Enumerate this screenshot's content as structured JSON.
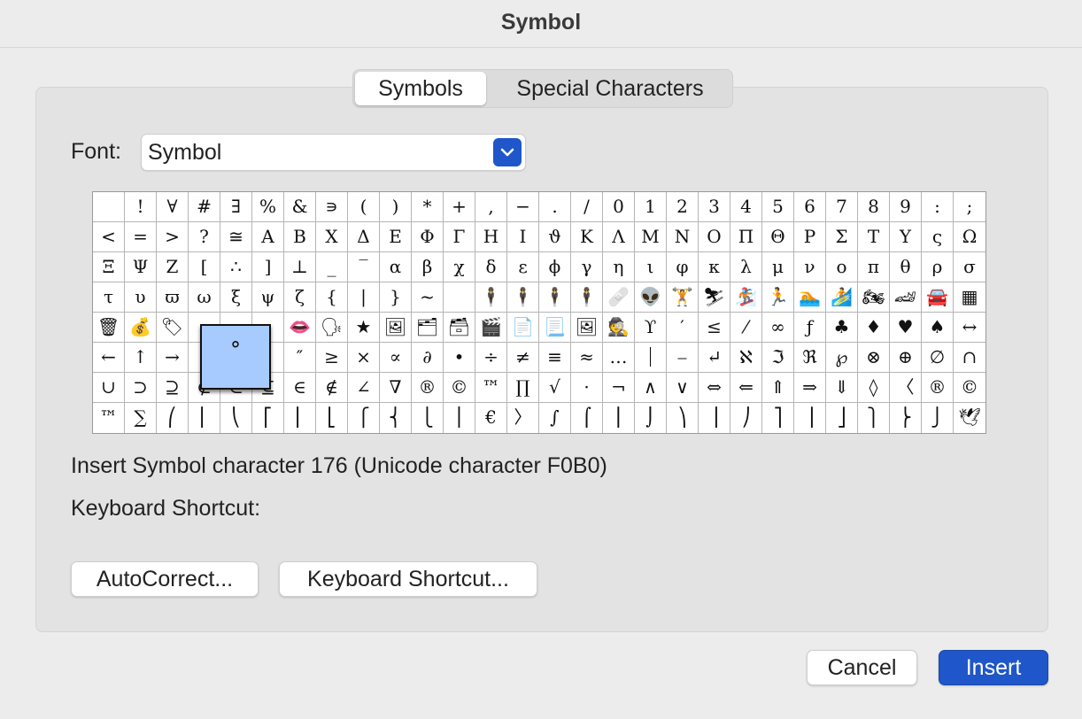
{
  "window": {
    "title": "Symbol"
  },
  "tabs": [
    {
      "label": "Symbols",
      "selected": true
    },
    {
      "label": "Special Characters",
      "selected": false
    }
  ],
  "font": {
    "label": "Font:",
    "value": "Symbol"
  },
  "grid": {
    "rows": [
      [
        "",
        "!",
        "∀",
        "#",
        "∃",
        "%",
        "&",
        "∍",
        "(",
        ")",
        "*",
        "+",
        ",",
        "−",
        ".",
        "/",
        "0",
        "1",
        "2",
        "3",
        "4",
        "5",
        "6",
        "7",
        "8",
        "9",
        ":",
        ";"
      ],
      [
        "<",
        "=",
        ">",
        "?",
        "≅",
        "Α",
        "Β",
        "Χ",
        "Δ",
        "Ε",
        "Φ",
        "Γ",
        "Η",
        "Ι",
        "ϑ",
        "Κ",
        "Λ",
        "Μ",
        "Ν",
        "Ο",
        "Π",
        "Θ",
        "Ρ",
        "Σ",
        "Τ",
        "Υ",
        "ς",
        "Ω"
      ],
      [
        "Ξ",
        "Ψ",
        "Ζ",
        "[",
        "∴",
        "]",
        "⊥",
        "_",
        "‾",
        "α",
        "β",
        "χ",
        "δ",
        "ε",
        "ϕ",
        "γ",
        "η",
        "ι",
        "φ",
        "κ",
        "λ",
        "μ",
        "ν",
        "ο",
        "π",
        "θ",
        "ρ",
        "σ"
      ],
      [
        "τ",
        "υ",
        "ϖ",
        "ω",
        "ξ",
        "ψ",
        "ζ",
        "{",
        "|",
        "}",
        "~",
        "",
        "🕴",
        "🕴",
        "🕴",
        "🕴",
        "🩹",
        "👽",
        "🏋",
        "⛷",
        "🏂",
        "🏃",
        "🏊",
        "🏄",
        "🏍",
        "🏎",
        "🚘",
        "▦"
      ],
      [
        "🗑",
        "💰",
        "🏷",
        "",
        "",
        "",
        "👄",
        "🗣",
        "★",
        "🖼",
        "🗂",
        "🗃",
        "🎬",
        "📄",
        "📃",
        "🖼",
        "🕵",
        "ϒ",
        "′",
        "≤",
        "⁄",
        "∞",
        "ƒ",
        "♣",
        "♦",
        "♥",
        "♠",
        "↔"
      ],
      [
        "←",
        "↑",
        "→",
        "",
        "",
        "",
        "″",
        "≥",
        "×",
        "∝",
        "∂",
        "•",
        "÷",
        "≠",
        "≡",
        "≈",
        "…",
        "⏐",
        "⎯",
        "↵",
        "ℵ",
        "ℑ",
        "ℜ",
        "℘",
        "⊗",
        "⊕",
        "∅",
        "∩"
      ],
      [
        "∪",
        "⊃",
        "⊇",
        "⊄",
        "⊂",
        "⊆",
        "∈",
        "∉",
        "∠",
        "∇",
        "®",
        "©",
        "™",
        "∏",
        "√",
        "⋅",
        "¬",
        "∧",
        "∨",
        "⇔",
        "⇐",
        "⇑",
        "⇒",
        "⇓",
        "◊",
        "〈",
        "®",
        "©"
      ],
      [
        "™",
        "∑",
        "⎛",
        "⎜",
        "⎝",
        "⎡",
        "⎢",
        "⎣",
        "⎧",
        "⎨",
        "⎩",
        "⎪",
        "€",
        "〉",
        "∫",
        "⌠",
        "⎮",
        "⌡",
        "⎞",
        "⎟",
        "⎠",
        "⎤",
        "⎥",
        "⎦",
        "⎫",
        "⎬",
        "⎭",
        "🕊"
      ]
    ],
    "preview_char": "°"
  },
  "info": {
    "insert_text": "Insert Symbol character 176  (Unicode character F0B0)",
    "shortcut_label": "Keyboard Shortcut:"
  },
  "buttons": {
    "autocorrect": "AutoCorrect...",
    "keyboard_shortcut": "Keyboard Shortcut...",
    "cancel": "Cancel",
    "insert": "Insert"
  },
  "colors": {
    "accent": "#1f56c9",
    "preview_bg": "#a8cbff"
  },
  "icons": {
    "dropdown": "chevron-down-icon"
  }
}
